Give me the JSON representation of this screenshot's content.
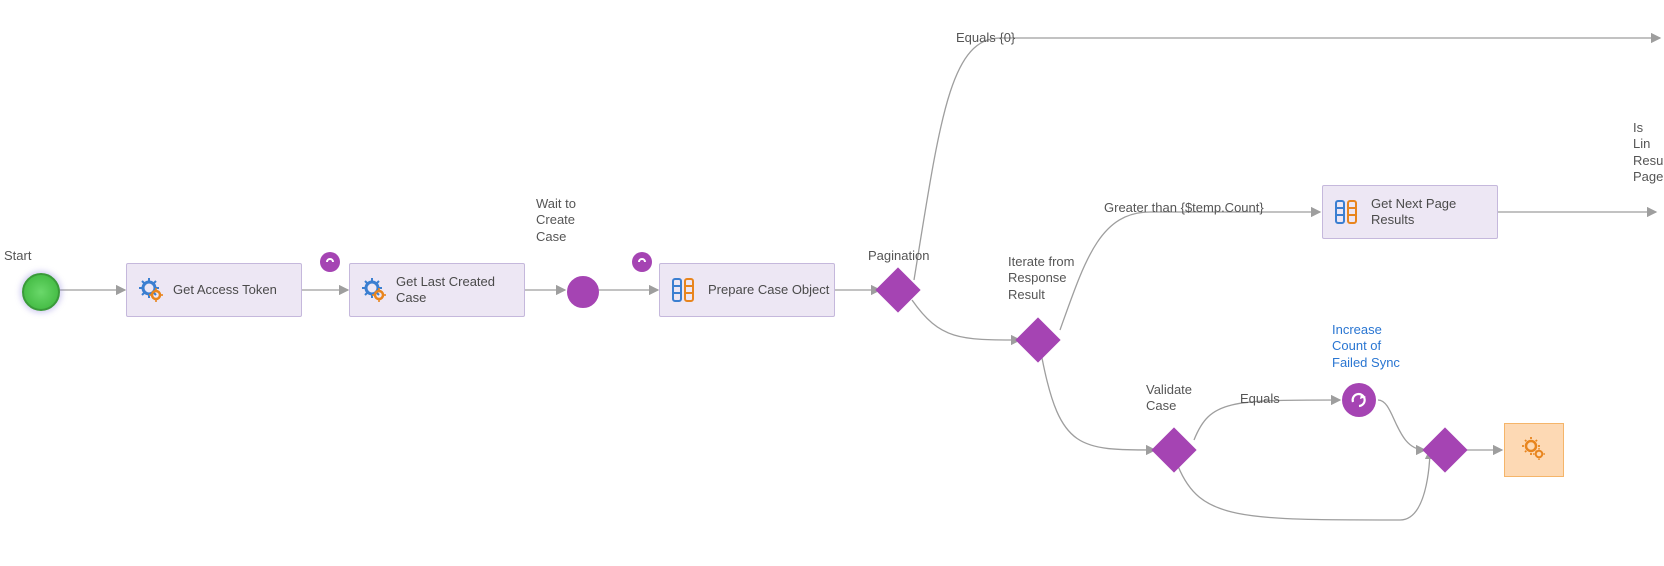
{
  "labels": {
    "start": "Start",
    "getAccess": "Get Access\nToken",
    "getLast": "Get Last\nCreated Case",
    "waitCreate": "Wait to\nCreate\nCase",
    "prepareCase": "Prepare Case\nObject",
    "pagination": "Pagination",
    "equalsZero": "Equals {0}",
    "iterate": "Iterate from\nResponse\nResult",
    "greaterThan": "Greater than {$temp.Count}",
    "getNext": "Get Next Page\nResults",
    "isLin": "Is Lin\nResu\nPage",
    "validateCase": "Validate\nCase",
    "equals": "Equals",
    "increaseCount": "Increase\nCount of\nFailed Sync"
  },
  "colors": {
    "purple": "#a544b3",
    "taskFill": "#ede7f4",
    "taskBorder": "#c5b8dc",
    "orangeFill": "#fdd9b4",
    "green": "#52c552",
    "linkBlue": "#2a76d2",
    "edge": "#9e9e9e"
  }
}
